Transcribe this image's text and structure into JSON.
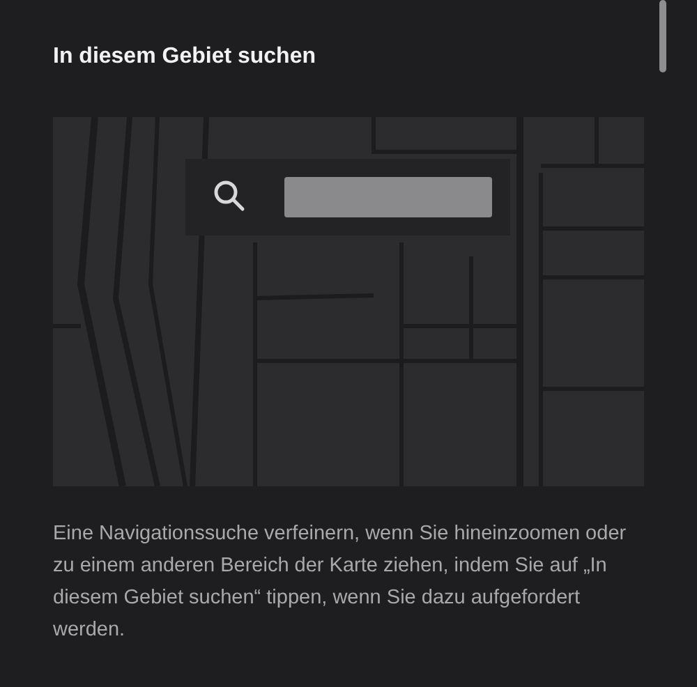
{
  "section": {
    "title": "In diesem Gebiet suchen",
    "description": "Eine Navigationssuche verfeinern, wenn Sie hineinzoomen oder zu einem anderen Bereich der Karte ziehen, indem Sie auf „In diesem Gebiet suchen“ tippen, wenn Sie dazu aufgefordert werden."
  }
}
